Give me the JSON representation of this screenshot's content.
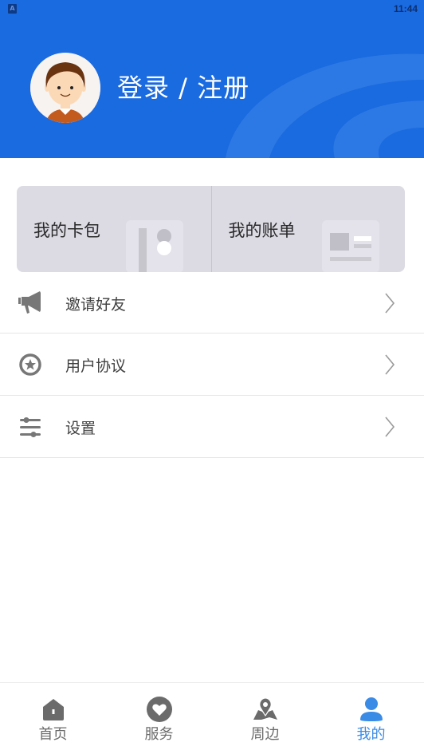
{
  "status_bar": {
    "app_indicator": "A",
    "time": "11:44"
  },
  "header": {
    "login_text": "登录 / 注册",
    "background_color": "#1a6ae0"
  },
  "cards": [
    {
      "label": "我的卡包",
      "icon": "card-holder-icon"
    },
    {
      "label": "我的账单",
      "icon": "bill-icon"
    }
  ],
  "menu": [
    {
      "label": "邀请好友",
      "icon": "megaphone-icon"
    },
    {
      "label": "用户协议",
      "icon": "star-badge-icon"
    },
    {
      "label": "设置",
      "icon": "sliders-icon"
    }
  ],
  "tabbar": {
    "active_color": "#3a8be6",
    "inactive_color": "#6b6b6b",
    "items": [
      {
        "label": "首页",
        "icon": "home-icon",
        "active": false
      },
      {
        "label": "服务",
        "icon": "heart-icon",
        "active": false
      },
      {
        "label": "周边",
        "icon": "map-pin-icon",
        "active": false
      },
      {
        "label": "我的",
        "icon": "user-icon",
        "active": true
      }
    ]
  }
}
